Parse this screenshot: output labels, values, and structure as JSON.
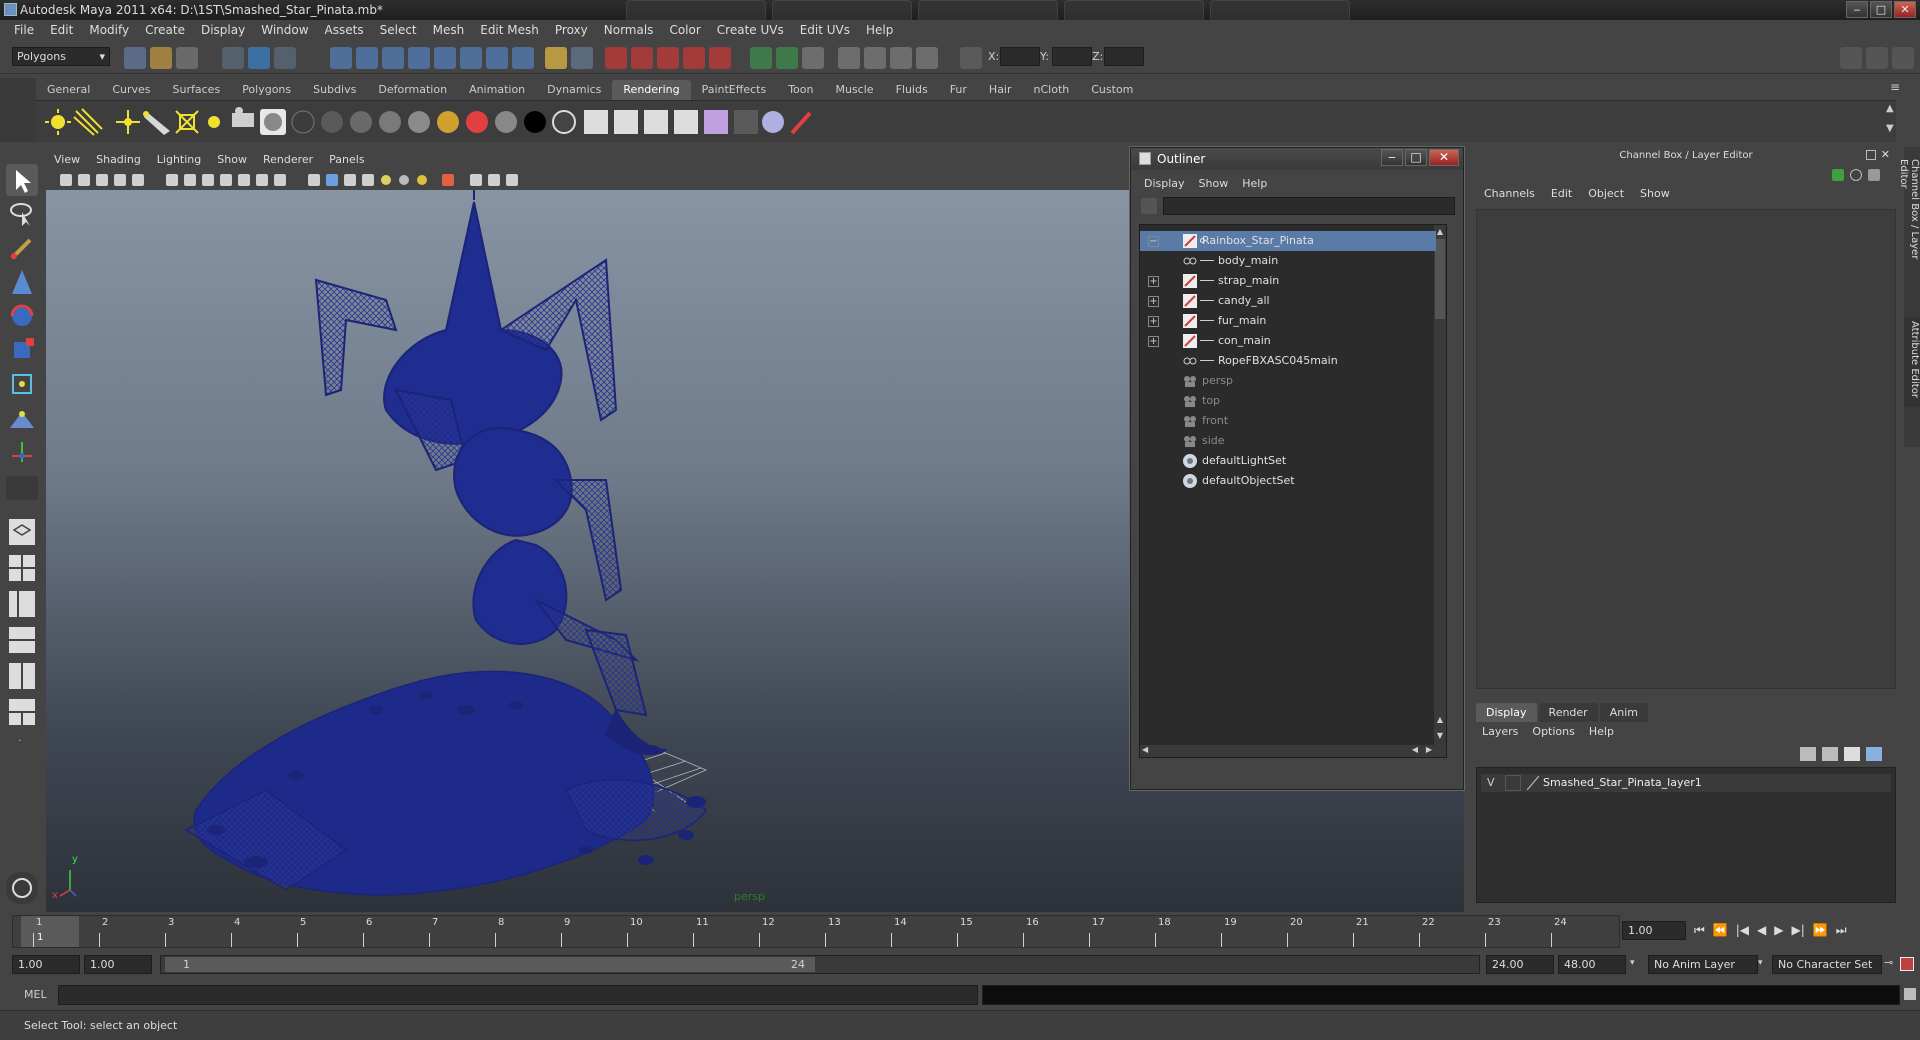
{
  "window": {
    "title": "Autodesk Maya 2011 x64: D:\\1ST\\Smashed_Star_Pinata.mb*",
    "minimize": "‒",
    "maximize": "□",
    "close": "✕"
  },
  "menubar": [
    "File",
    "Edit",
    "Modify",
    "Create",
    "Display",
    "Window",
    "Assets",
    "Select",
    "Mesh",
    "Edit Mesh",
    "Proxy",
    "Normals",
    "Color",
    "Create UVs",
    "Edit UVs",
    "Help"
  ],
  "statusline": {
    "menuset": "Polygons",
    "x_label": "X:",
    "y_label": "Y:",
    "z_label": "Z:"
  },
  "shelf": {
    "tabs": [
      "General",
      "Curves",
      "Surfaces",
      "Polygons",
      "Subdivs",
      "Deformation",
      "Animation",
      "Dynamics",
      "Rendering",
      "PaintEffects",
      "Toon",
      "Muscle",
      "Fluids",
      "Fur",
      "Hair",
      "nCloth",
      "Custom"
    ],
    "active_tab": "Rendering"
  },
  "viewport": {
    "menus": [
      "View",
      "Shading",
      "Lighting",
      "Show",
      "Renderer",
      "Panels"
    ],
    "camera_label": "persp",
    "axis_x": "x",
    "axis_y": "y"
  },
  "outliner": {
    "title": "Outliner",
    "menus": [
      "Display",
      "Show",
      "Help"
    ],
    "items": [
      {
        "label": "Rainbox_Star_Pinata",
        "type": "transform",
        "expander": "−",
        "selected": true,
        "dim": false
      },
      {
        "label": "body_main",
        "type": "mesh",
        "expander": "",
        "selected": false,
        "dim": false
      },
      {
        "label": "strap_main",
        "type": "transform",
        "expander": "+",
        "selected": false,
        "dim": false
      },
      {
        "label": "candy_all",
        "type": "transform",
        "expander": "+",
        "selected": false,
        "dim": false
      },
      {
        "label": "fur_main",
        "type": "transform",
        "expander": "+",
        "selected": false,
        "dim": false
      },
      {
        "label": "con_main",
        "type": "transform",
        "expander": "+",
        "selected": false,
        "dim": false
      },
      {
        "label": "RopeFBXASC045main",
        "type": "mesh",
        "expander": "",
        "selected": false,
        "dim": false
      },
      {
        "label": "persp",
        "type": "camera",
        "expander": "",
        "selected": false,
        "dim": true
      },
      {
        "label": "top",
        "type": "camera",
        "expander": "",
        "selected": false,
        "dim": true
      },
      {
        "label": "front",
        "type": "camera",
        "expander": "",
        "selected": false,
        "dim": true
      },
      {
        "label": "side",
        "type": "camera",
        "expander": "",
        "selected": false,
        "dim": true
      },
      {
        "label": "defaultLightSet",
        "type": "set",
        "expander": "",
        "selected": false,
        "dim": false
      },
      {
        "label": "defaultObjectSet",
        "type": "set",
        "expander": "",
        "selected": false,
        "dim": false
      }
    ]
  },
  "channelbox": {
    "title": "Channel Box / Layer Editor",
    "menus": [
      "Channels",
      "Edit",
      "Object",
      "Show"
    ],
    "layer_tabs": [
      "Display",
      "Render",
      "Anim"
    ],
    "active_layer_tab": "Display",
    "layer_menus": [
      "Layers",
      "Options",
      "Help"
    ],
    "layer": {
      "visibility": "V",
      "name": "Smashed_Star_Pinata_layer1"
    },
    "side_tabs": [
      "Channel Box / Layer Editor",
      "Attribute Editor"
    ]
  },
  "timeslider": {
    "frames": [
      "1",
      "2",
      "3",
      "4",
      "5",
      "6",
      "7",
      "8",
      "9",
      "10",
      "11",
      "12",
      "13",
      "14",
      "15",
      "16",
      "17",
      "18",
      "19",
      "20",
      "21",
      "22",
      "23",
      "24"
    ],
    "current_frame": "1",
    "current_time_field": "1.00"
  },
  "range": {
    "start_time": "1.00",
    "playback_start": "1.00",
    "range_start_label": "1",
    "range_end_label": "24",
    "playback_end": "24.00",
    "end_time": "48.00",
    "anim_layer": "No Anim Layer",
    "character_set": "No Character Set"
  },
  "commandline": {
    "label": "MEL"
  },
  "helpline": {
    "text": "Select Tool: select an object"
  },
  "colors": {
    "wire": "#1c2478",
    "selected_row": "#5a7aa8",
    "bg": "#444444"
  }
}
